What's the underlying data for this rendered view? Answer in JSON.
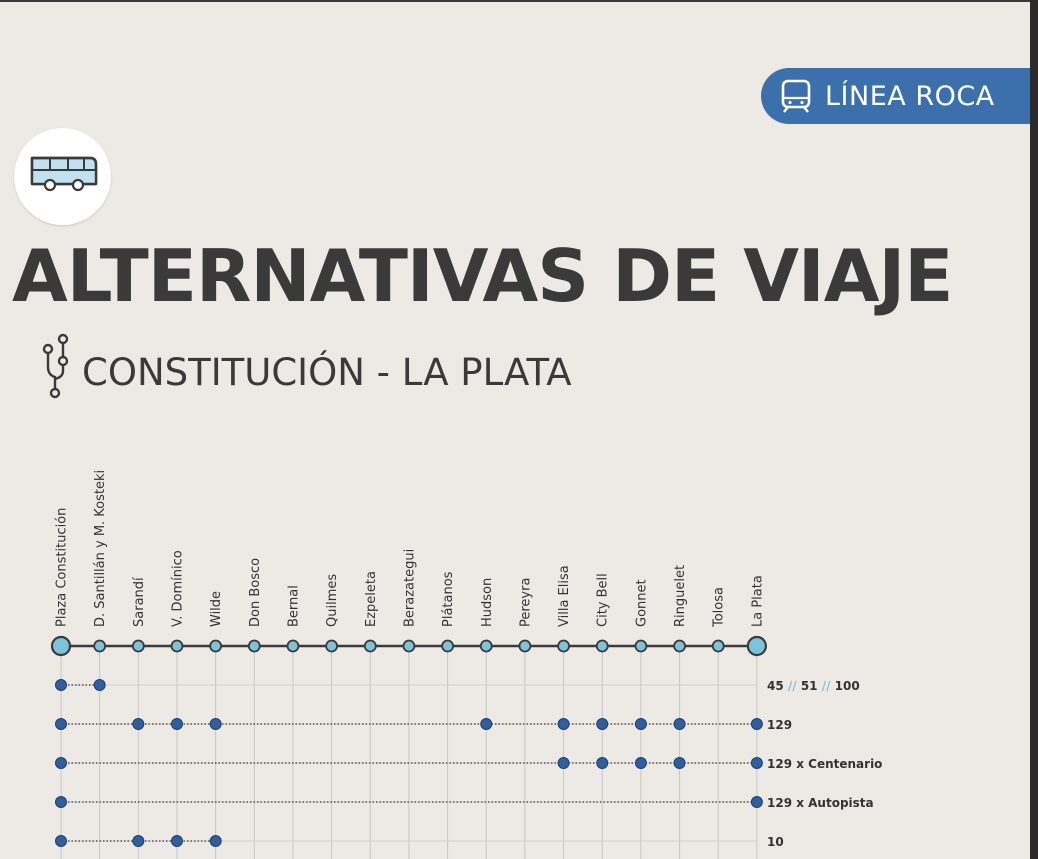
{
  "badge": {
    "label": "LÍNEA ROCA"
  },
  "title": "ALTERNATIVAS DE VIAJE",
  "subtitle": "CONSTITUCIÓN - LA PLATA",
  "colors": {
    "accent": "#3b70ad",
    "stop_fill": "#7ec3dc",
    "service_dot": "#2f5f9e",
    "text": "#3a3a3a",
    "slash": "#7ec3dc"
  },
  "stations": [
    "Plaza Constitución",
    "D. Santillán y M. Kosteki",
    "Sarandí",
    "V. Domínico",
    "Wilde",
    "Don Bosco",
    "Bernal",
    "Quilmes",
    "Ezpeleta",
    "Berazategui",
    "Plátanos",
    "Hudson",
    "Pereyra",
    "Villa Elisa",
    "City Bell",
    "Gonnet",
    "Ringuelet",
    "Tolosa",
    "La Plata"
  ],
  "terminal_stations": [
    0,
    18
  ],
  "services": [
    {
      "parts": [
        "45",
        "51",
        "100"
      ],
      "separator": "//",
      "stops": [
        0,
        1
      ]
    },
    {
      "parts": [
        "129"
      ],
      "stops": [
        0,
        2,
        3,
        4,
        11,
        13,
        14,
        15,
        16,
        18
      ]
    },
    {
      "parts": [
        "129 x Centenario"
      ],
      "stops": [
        0,
        13,
        14,
        15,
        16,
        18
      ]
    },
    {
      "parts": [
        "129 x Autopista"
      ],
      "stops": [
        0,
        18
      ]
    },
    {
      "parts": [
        "10"
      ],
      "stops": [
        0,
        2,
        3,
        4
      ]
    }
  ]
}
